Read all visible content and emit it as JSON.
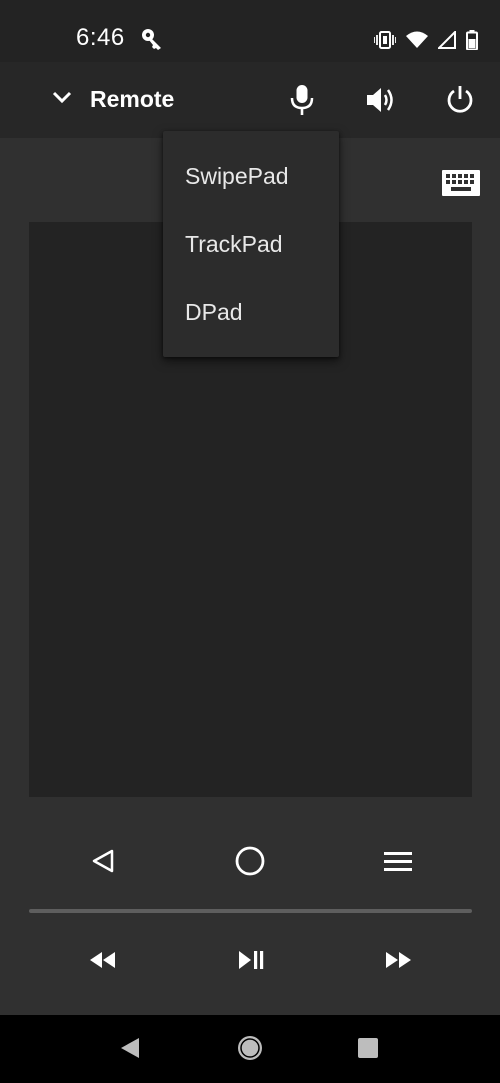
{
  "status_bar": {
    "time": "6:46",
    "icons": [
      "key-icon",
      "vibrate-icon",
      "wifi-icon",
      "signal-icon",
      "battery-icon"
    ]
  },
  "app_bar": {
    "title": "Remote",
    "actions": [
      "microphone-icon",
      "volume-icon",
      "power-icon"
    ]
  },
  "menu": {
    "items": [
      {
        "label": "SwipePad"
      },
      {
        "label": "TrackPad"
      },
      {
        "label": "DPad"
      }
    ]
  },
  "controls": {
    "navigation": [
      "back-icon",
      "home-icon",
      "menu-icon"
    ],
    "media": [
      "rewind-icon",
      "play-pause-icon",
      "fast-forward-icon"
    ]
  },
  "system_nav": [
    "system-back-icon",
    "system-home-icon",
    "system-recents-icon"
  ],
  "colors": {
    "background": "#303030",
    "app_bar": "#272727",
    "status_bar": "#232323",
    "touch_area": "#232323",
    "menu": "#2c2c2c",
    "divider": "#5e5e5e"
  }
}
